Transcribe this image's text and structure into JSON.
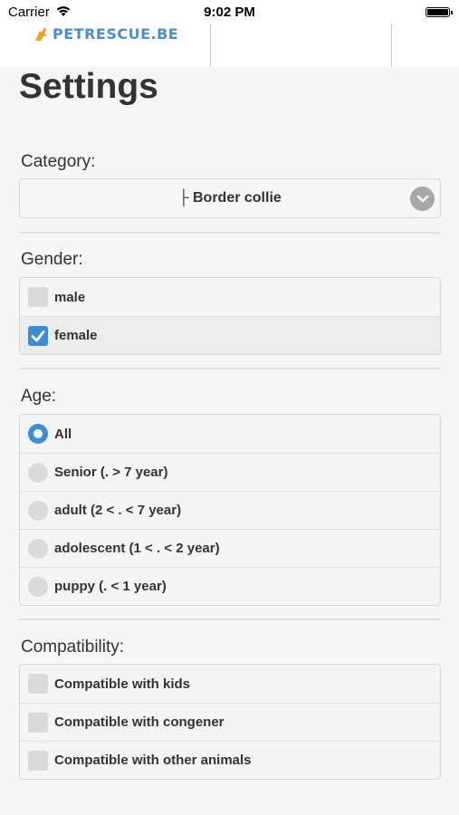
{
  "status_bar": {
    "carrier": "Carrier",
    "time": "9:02 PM"
  },
  "header": {
    "logo_text": "PETRESCUE.BE"
  },
  "page": {
    "title": "Settings"
  },
  "category": {
    "label": "Category:",
    "selected": "├ Border collie"
  },
  "gender": {
    "label": "Gender:",
    "options": [
      {
        "label": "male",
        "checked": false
      },
      {
        "label": "female",
        "checked": true
      }
    ]
  },
  "age": {
    "label": "Age:",
    "options": [
      {
        "label": "All",
        "selected": true
      },
      {
        "label": "Senior (. > 7 year)",
        "selected": false
      },
      {
        "label": "adult (2 < . < 7 year)",
        "selected": false
      },
      {
        "label": "adolescent (1 < . < 2 year)",
        "selected": false
      },
      {
        "label": "puppy (. < 1 year)",
        "selected": false
      }
    ]
  },
  "compatibility": {
    "label": "Compatibility:",
    "options": [
      {
        "label": "Compatible with kids",
        "checked": false
      },
      {
        "label": "Compatible with congener",
        "checked": false
      },
      {
        "label": "Compatible with other animals",
        "checked": false
      }
    ]
  },
  "colors": {
    "accent": "#3a8ed6",
    "logo": "#4a8fcb",
    "logo_mark": "#f0a020"
  }
}
